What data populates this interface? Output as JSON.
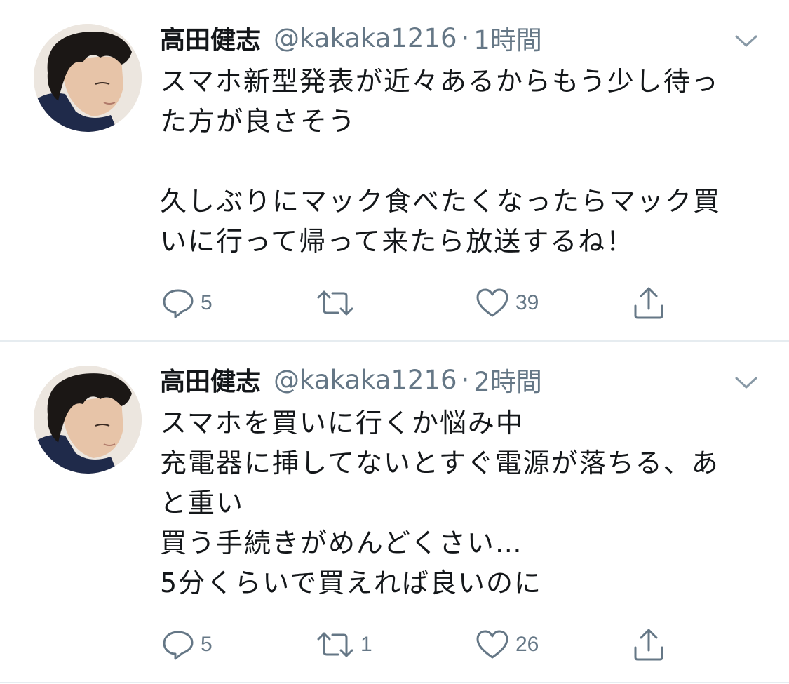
{
  "tweets": [
    {
      "display_name": "高田健志",
      "handle": "@kakaka1216",
      "separator": "·",
      "time": "1時間",
      "text_lines": [
        "スマホ新型発表が近々あるからもう少し待っ",
        "た方が良さそう",
        "",
        "久しぶりにマック食べたくなったらマック買",
        "いに行って帰って来たら放送するね！"
      ],
      "reply_count": "5",
      "retweet_count": "",
      "like_count": "39",
      "icons": {
        "reply": "reply-icon",
        "retweet": "retweet-icon",
        "like": "heart-icon",
        "share": "share-icon",
        "menu": "chevron-down-icon"
      }
    },
    {
      "display_name": "高田健志",
      "handle": "@kakaka1216",
      "separator": "·",
      "time": "2時間",
      "text_lines": [
        "スマホを買いに行くか悩み中",
        "充電器に挿してないとすぐ電源が落ちる、あ",
        "と重い",
        "買う手続きがめんどくさい…",
        "5分くらいで買えれば良いのに"
      ],
      "reply_count": "5",
      "retweet_count": "1",
      "like_count": "26",
      "icons": {
        "reply": "reply-icon",
        "retweet": "retweet-icon",
        "like": "heart-icon",
        "share": "share-icon",
        "menu": "chevron-down-icon"
      }
    }
  ],
  "colors": {
    "text": "#14171a",
    "secondary": "#657786",
    "divider": "#e6ecf0"
  }
}
